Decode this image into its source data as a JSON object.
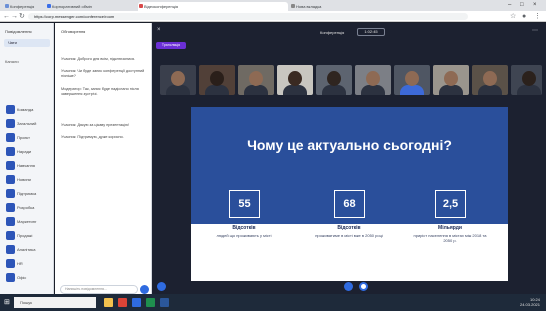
{
  "browser": {
    "tabs": [
      {
        "label": "Конференція",
        "active": false
      },
      {
        "label": "Корпоративний обмін",
        "active": false
      },
      {
        "label": "Відеоконференція",
        "active": true
      },
      {
        "label": "Нова вкладка",
        "active": false
      }
    ],
    "url": "https://corp.messenger.com/conference/room"
  },
  "sidebar": {
    "title": "Повідомлення",
    "active_item": "Чати",
    "section_label": "Канали",
    "items": [
      "Команда",
      "Загальний",
      "Проєкт",
      "Наради",
      "Навчання",
      "Новини",
      "Підтримка",
      "Розробка",
      "Маркетинг",
      "Продажі",
      "Аналітика",
      "HR",
      "Офіс"
    ]
  },
  "chat": {
    "title": "Обговорення",
    "messages": [
      "Учасник: Доброго дня всім, підключилися.",
      "Учасник: Чи буде запис конференції доступний пізніше?",
      "Модератор: Так, запис буде надіслано після завершення зустрічі.",
      "Учасник: Дякую за цікаву презентацію!",
      "Учасник: Підтримую, дуже корисно."
    ],
    "input_placeholder": "Напишіть повідомлення..."
  },
  "conference": {
    "title": "Конференція",
    "timer": "1:02:45",
    "badge": "Трансляція"
  },
  "slide": {
    "heading": "Чому це актуально сьогодні?",
    "stats": [
      {
        "value": "55",
        "unit": "Відсотків",
        "description": "людей що проживають у місті"
      },
      {
        "value": "68",
        "unit": "Відсотків",
        "description": "проживатиме в місті вже в 2050 році"
      },
      {
        "value": "2,5",
        "unit": "Мільярди",
        "description": "приріст населення в містах між 2018 та 2050 р."
      }
    ]
  },
  "taskbar": {
    "search_placeholder": "Пошук",
    "time": "10:24",
    "date": "24.03.2021"
  },
  "colors": {
    "slide_blue": "#2a4f9b",
    "accent_purple": "#6b2fd6",
    "conference_bg": "#1c2130"
  }
}
